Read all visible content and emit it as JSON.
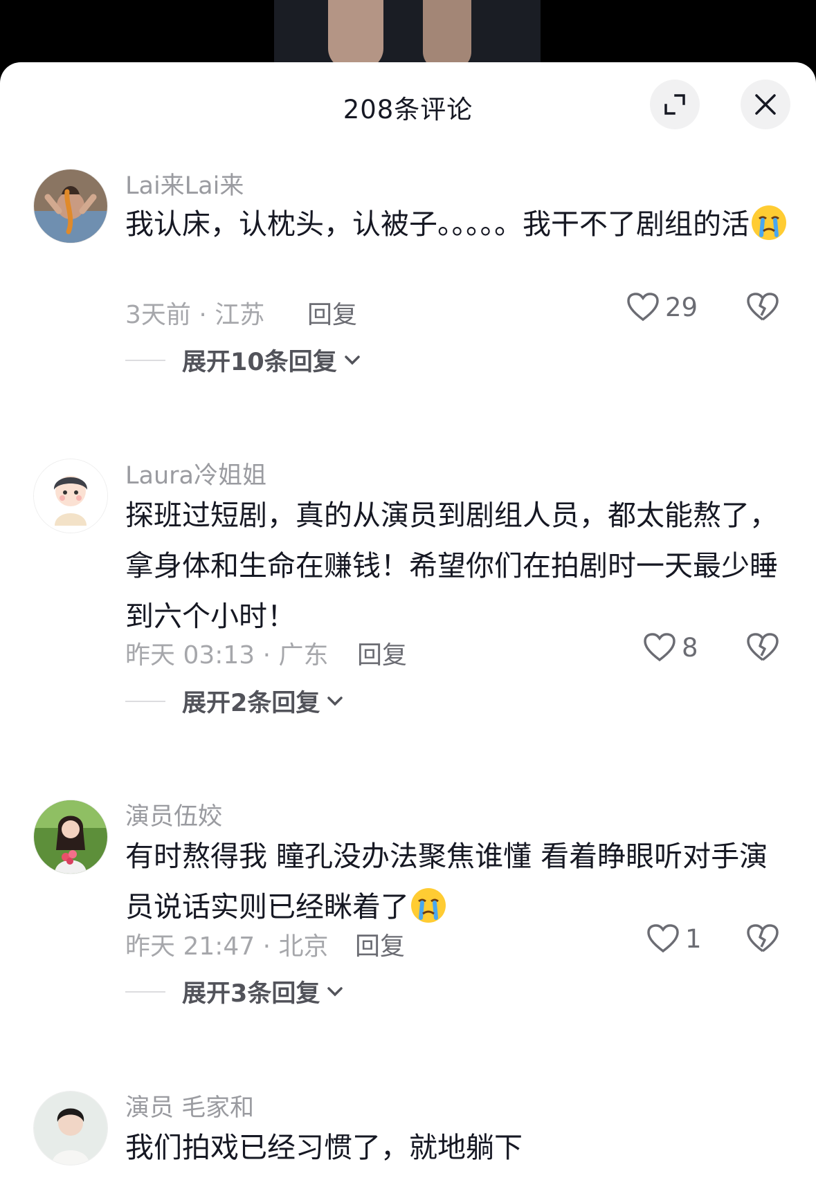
{
  "header": {
    "title": "208条评论"
  },
  "comments": [
    {
      "username": "Lai来Lai来",
      "text": "我认床，认枕头，认被子。。。。。我干不了剧组的活",
      "meta": "3天前 · 江苏",
      "reply_label": "回复",
      "likes": "29",
      "expand_label": "展开10条回复"
    },
    {
      "username": "Laura冷姐姐",
      "text": "探班过短剧，真的从演员到剧组人员，都太能熬了，拿身体和生命在赚钱！希望你们在拍剧时一天最少睡到六个小时！",
      "meta": "昨天 03:13 · 广东",
      "reply_label": "回复",
      "likes": "8",
      "expand_label": "展开2条回复"
    },
    {
      "username": "演员伍姣",
      "text": "有时熬得我 瞳孔没办法聚焦谁懂 看着睁眼听对手演员说话实则已经眯着了",
      "meta": "昨天 21:47 · 北京",
      "reply_label": "回复",
      "likes": "1",
      "expand_label": "展开3条回复"
    },
    {
      "username": "演员 毛家和",
      "text": "我们拍戏已经习惯了，就地躺下"
    }
  ],
  "colors": {
    "text_primary": "#161823",
    "text_secondary": "#9a9ba0",
    "sheet_bg": "#ffffff",
    "button_bg": "#f1f1f2"
  },
  "icons": [
    "expand-icon",
    "close-icon",
    "heart-icon",
    "broken-heart-icon",
    "chevron-down-icon",
    "crying-emoji-icon"
  ]
}
